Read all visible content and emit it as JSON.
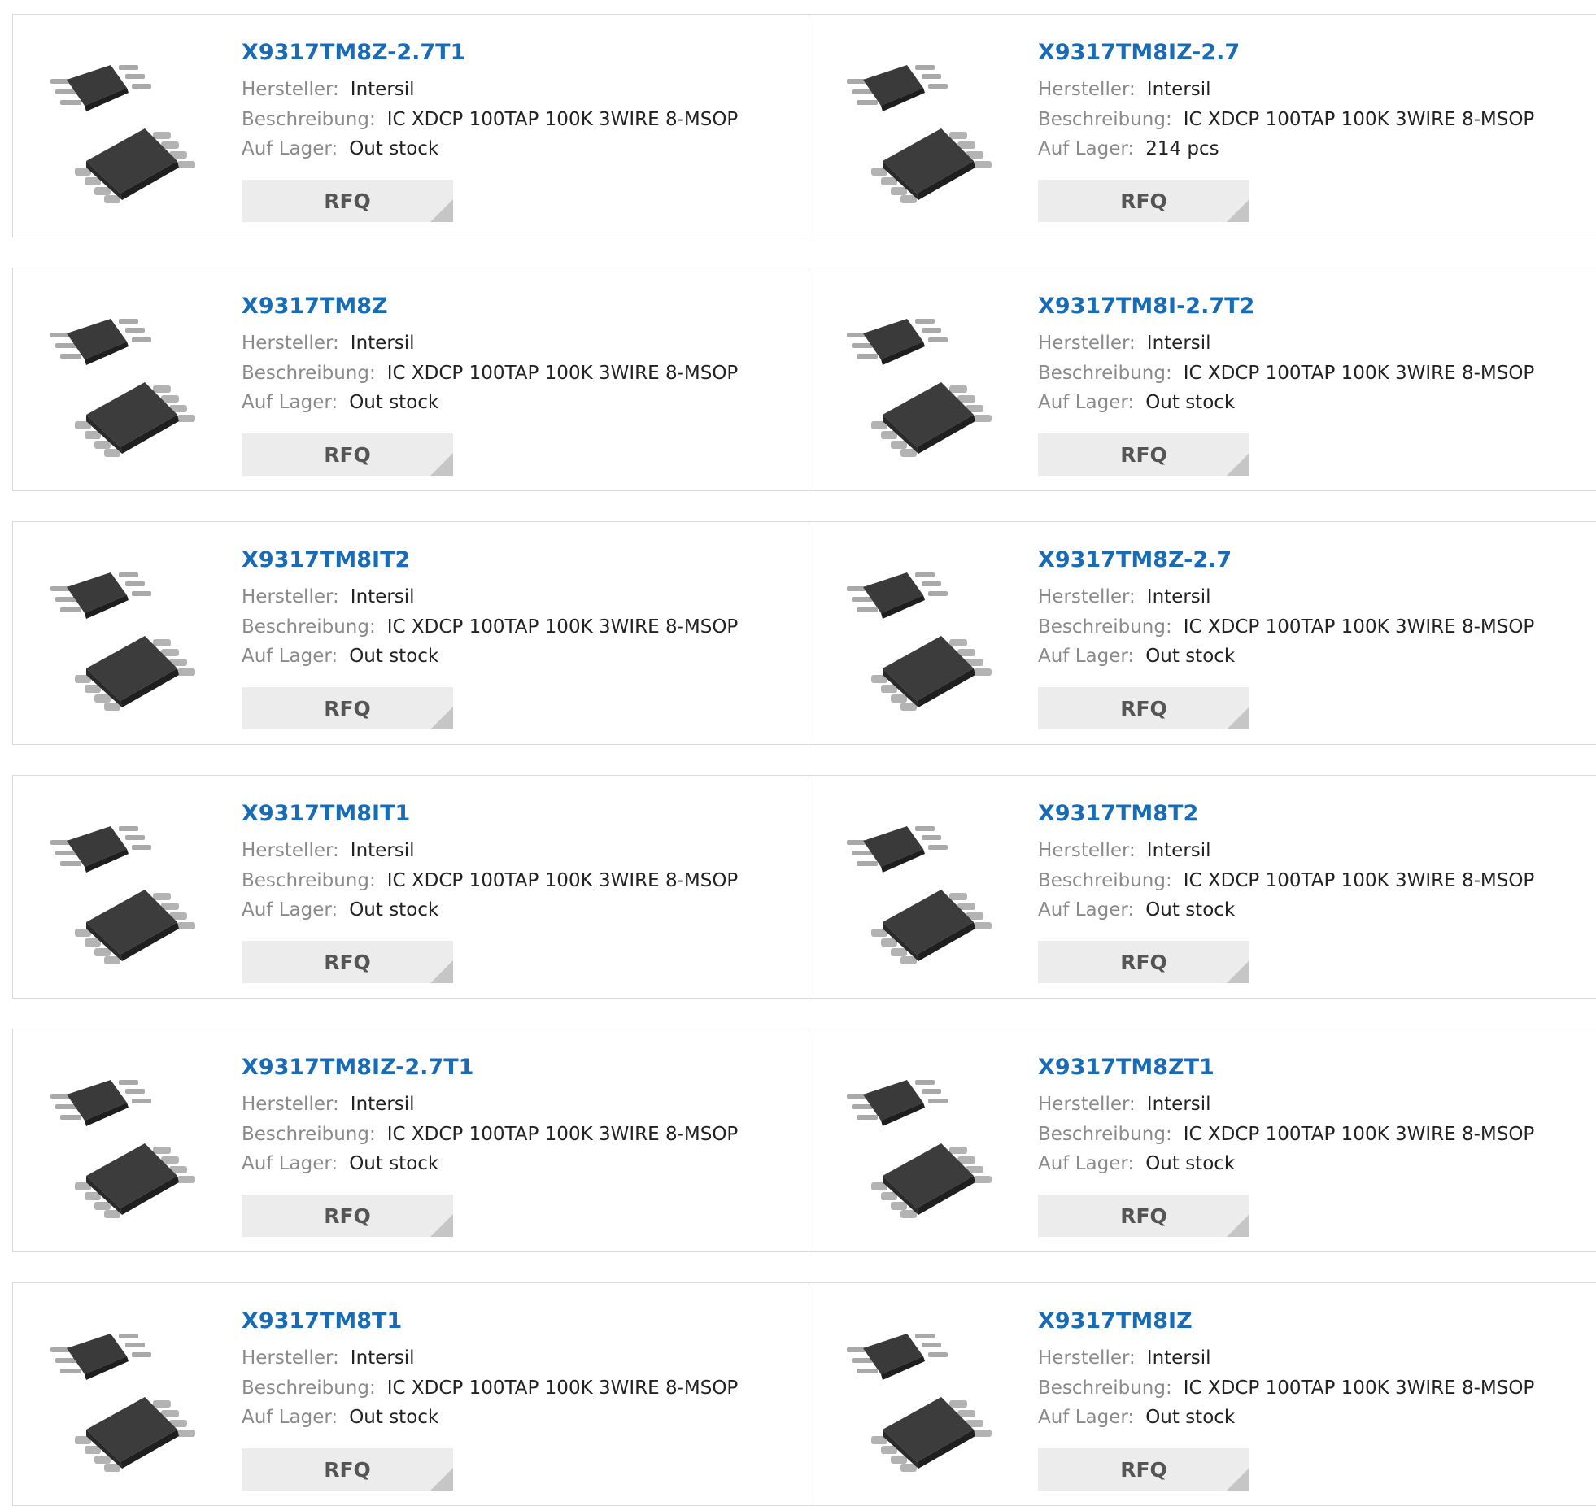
{
  "labels": {
    "manufacturer": "Hersteller:",
    "description": "Beschreibung:",
    "stock": "Auf Lager:",
    "rfq": "RFQ"
  },
  "products": [
    {
      "part": "X9317TM8Z-2.7T1",
      "manufacturer": "Intersil",
      "description": "IC XDCP 100TAP 100K 3WIRE 8-MSOP",
      "stock": "Out stock"
    },
    {
      "part": "X9317TM8IZ-2.7",
      "manufacturer": "Intersil",
      "description": "IC XDCP 100TAP 100K 3WIRE 8-MSOP",
      "stock": "214 pcs"
    },
    {
      "part": "X9317TM8Z",
      "manufacturer": "Intersil",
      "description": "IC XDCP 100TAP 100K 3WIRE 8-MSOP",
      "stock": "Out stock"
    },
    {
      "part": "X9317TM8I-2.7T2",
      "manufacturer": "Intersil",
      "description": "IC XDCP 100TAP 100K 3WIRE 8-MSOP",
      "stock": "Out stock"
    },
    {
      "part": "X9317TM8IT2",
      "manufacturer": "Intersil",
      "description": "IC XDCP 100TAP 100K 3WIRE 8-MSOP",
      "stock": "Out stock"
    },
    {
      "part": "X9317TM8Z-2.7",
      "manufacturer": "Intersil",
      "description": "IC XDCP 100TAP 100K 3WIRE 8-MSOP",
      "stock": "Out stock"
    },
    {
      "part": "X9317TM8IT1",
      "manufacturer": "Intersil",
      "description": "IC XDCP 100TAP 100K 3WIRE 8-MSOP",
      "stock": "Out stock"
    },
    {
      "part": "X9317TM8T2",
      "manufacturer": "Intersil",
      "description": "IC XDCP 100TAP 100K 3WIRE 8-MSOP",
      "stock": "Out stock"
    },
    {
      "part": "X9317TM8IZ-2.7T1",
      "manufacturer": "Intersil",
      "description": "IC XDCP 100TAP 100K 3WIRE 8-MSOP",
      "stock": "Out stock"
    },
    {
      "part": "X9317TM8ZT1",
      "manufacturer": "Intersil",
      "description": "IC XDCP 100TAP 100K 3WIRE 8-MSOP",
      "stock": "Out stock"
    },
    {
      "part": "X9317TM8T1",
      "manufacturer": "Intersil",
      "description": "IC XDCP 100TAP 100K 3WIRE 8-MSOP",
      "stock": "Out stock"
    },
    {
      "part": "X9317TM8IZ",
      "manufacturer": "Intersil",
      "description": "IC XDCP 100TAP 100K 3WIRE 8-MSOP",
      "stock": "Out stock"
    }
  ],
  "thumbnail_icon": "msop-8-chip-icon",
  "colors": {
    "title": "#1a6bb5",
    "label": "#8a8a8a",
    "value": "#222222",
    "button_bg": "#ececec",
    "button_text": "#555555",
    "border": "#d9d9d9"
  }
}
